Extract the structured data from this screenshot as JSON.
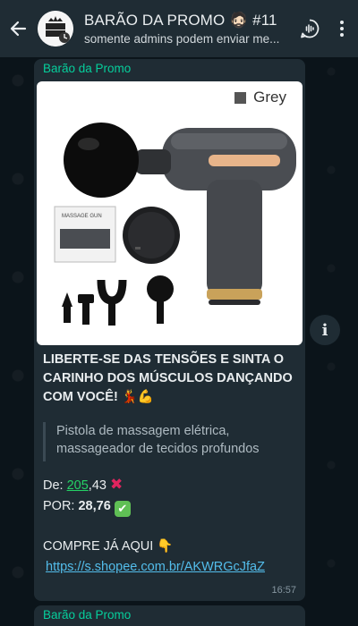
{
  "header": {
    "title": "BARÃO DA PROMO 🧔🏻 #11",
    "subtitle": "somente admins podem enviar me...",
    "avatar_text": "BARÃO DA PROMO"
  },
  "message": {
    "sender": "Barão da Promo",
    "image_variant_label": "Grey",
    "headline": "LIBERTE-SE DAS TENSÕES E SINTA O CARINHO DOS MÚSCULOS DANÇANDO COM VOCÊ! 💃💪",
    "quote": "Pistola de massagem elétrica, massageador de tecidos profundos",
    "price_from_prefix": "De: ",
    "price_from_link": "205",
    "price_from_suffix": ",43",
    "price_from_mark": "✖",
    "price_to_prefix": "POR: ",
    "price_to_value": "28,76",
    "price_to_mark": "✔",
    "cta": "COMPRE JÁ AQUI 👇",
    "link": "https://s.shopee.com.br/AKWRGcJfaZ",
    "time": "16:57",
    "box_label": "MASSAGE GUN"
  },
  "next_message": {
    "sender": "Barão da Promo"
  },
  "colors": {
    "header_bg": "#1f2c34",
    "bubble_bg": "#1f2c34",
    "sender": "#06cf9c",
    "link": "#53bdeb"
  }
}
